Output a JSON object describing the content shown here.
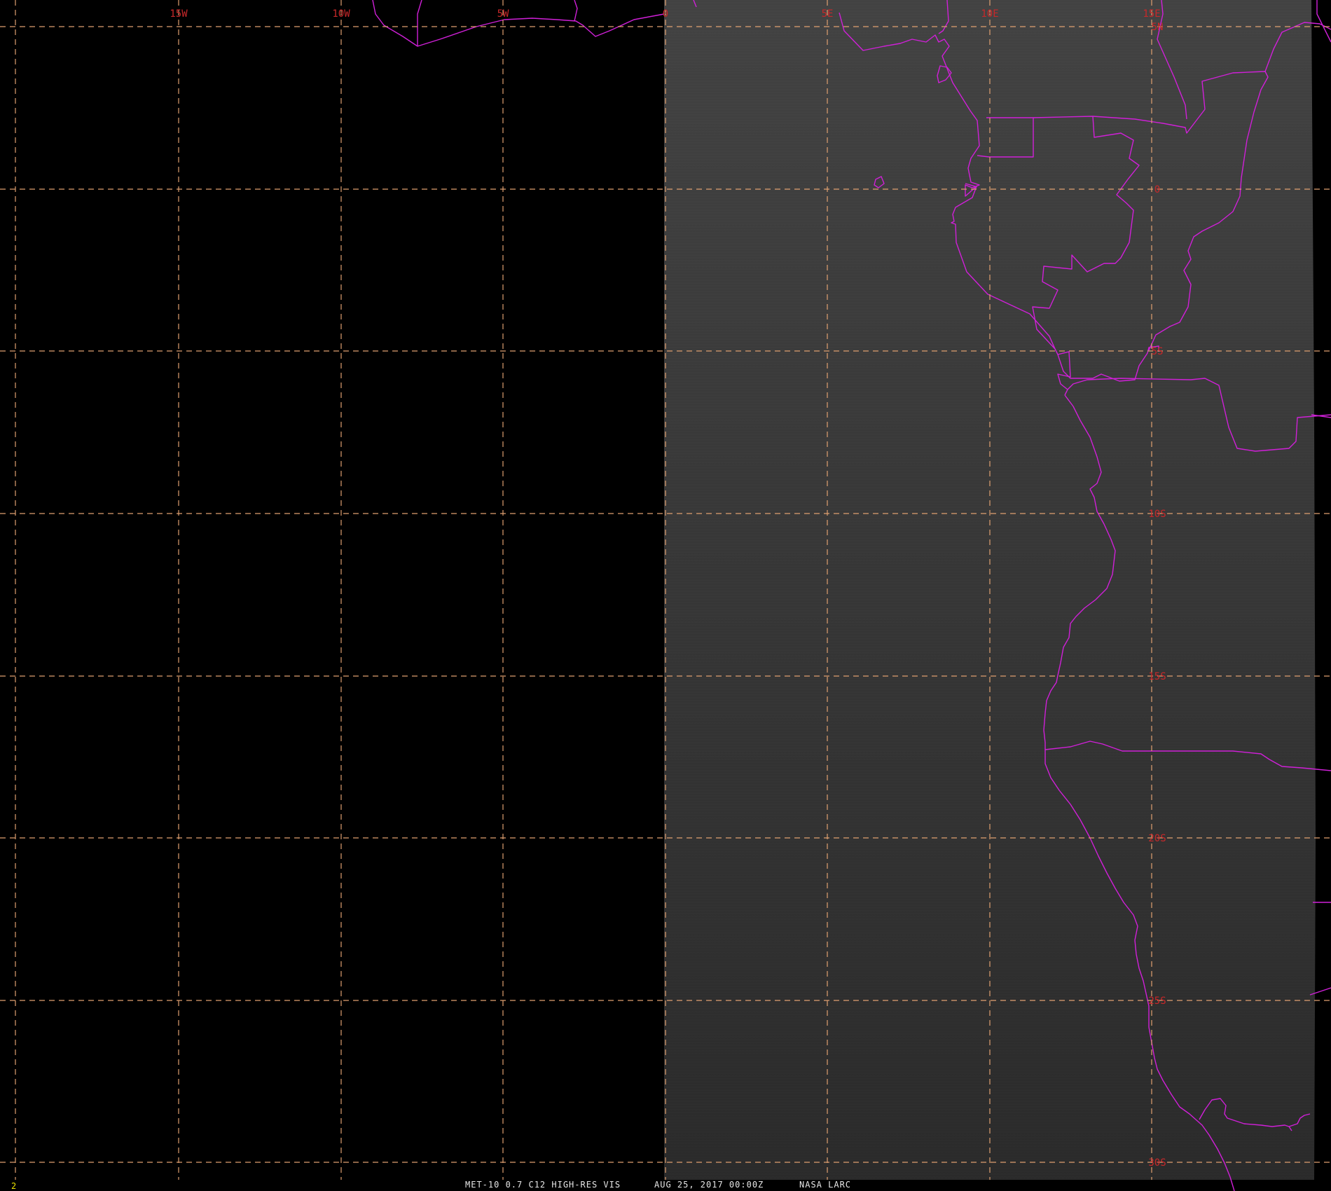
{
  "image": {
    "product": "MET-10 0.7 C12 HIGH-RES VIS",
    "datetime": "AUG 25, 2017 00:00Z",
    "source": "NASA LARC",
    "frame_number": "2"
  },
  "grid": {
    "longitude_labels": [
      "15W",
      "10W",
      "5W",
      "0",
      "5E",
      "10E",
      "15E"
    ],
    "latitude_labels": [
      "5N",
      "0",
      "5S",
      "10S",
      "15S",
      "20S",
      "25S",
      "30S"
    ]
  },
  "colors": {
    "background": "#000000",
    "scan_area": "#373737",
    "gridlines": "#e0a070",
    "coastlines": "#d020d8",
    "grid_labels": "#c8282a",
    "caption": "#e6e6e6",
    "frame_number": "#e8e000"
  }
}
